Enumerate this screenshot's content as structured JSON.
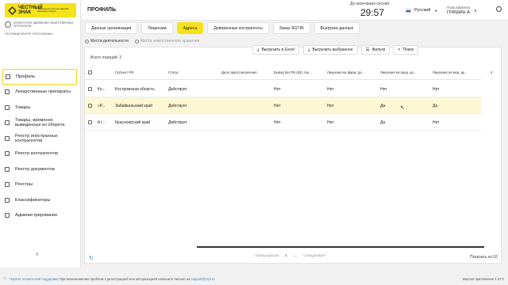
{
  "brand": {
    "name": "ЧЕСТНЫЙ ЗНАК",
    "subtitle": "национальная система цифровой маркировки товаров"
  },
  "org": {
    "name": "МОНИТОРИНГ ДВИЖЕНИЯ ЛЕКАРСТВЕННЫХ ПРЕПАРАТОВ",
    "center": "ТЕСТОВЫЙ КОНТУР «РЕСПУБЛИКА»"
  },
  "sidebar": {
    "items": [
      {
        "label": "Профиль",
        "icon": "person-icon"
      },
      {
        "label": "Лекарственные препараты",
        "icon": "pill-icon"
      },
      {
        "label": "Товары",
        "icon": "box-icon"
      },
      {
        "label": "Товары, временно выведенные из оборота",
        "icon": "box-out-icon"
      },
      {
        "label": "Реестр иностранных контрагентов",
        "icon": "globe-icon"
      },
      {
        "label": "Реестр контрагентов",
        "icon": "contacts-icon"
      },
      {
        "label": "Реестр документов",
        "icon": "document-icon"
      },
      {
        "label": "Реестры",
        "icon": "registry-icon"
      },
      {
        "label": "Классификаторы",
        "icon": "classifier-icon"
      },
      {
        "label": "Администрирование",
        "icon": "settings-icon"
      }
    ],
    "collapse": "≡"
  },
  "header": {
    "title": "ПРОФИЛЬ",
    "session_label": "До окончания сессии:",
    "timer": "29:57",
    "language": "Русский",
    "user_label": "Пользователь",
    "user_name": "ГРИШИН А."
  },
  "tabs": [
    {
      "label": "Данные организации",
      "active": false
    },
    {
      "label": "Лицензии",
      "active": false
    },
    {
      "label": "Адреса",
      "active": true
    },
    {
      "label": "Доверенные контрагенты",
      "active": false
    },
    {
      "label": "Заказ SGTIN",
      "active": false
    },
    {
      "label": "Выгрузка данных",
      "active": false
    }
  ],
  "radios": {
    "activity": "Места деятельности",
    "storage": "Места ответственного хранения"
  },
  "toolbar": {
    "export_excel": "Выгрузить в Excel",
    "export_selected": "Выгрузить выбранное",
    "filter": "Фильтр",
    "search": "Поиск"
  },
  "table": {
    "total": "Всего позиций: 3",
    "columns": [
      "Субъект РФ",
      "Статус",
      "Дата приостановления",
      "Вывод без РВ (521 схе...",
      "Лицензия на фарм. де...",
      "Лицензия на прод. де...",
      "Лицензия на мед. де..."
    ],
    "rows": [
      {
        "c0": "Ко...",
        "region": "Костромская область",
        "status": "Действует",
        "date": "",
        "rv": "Нет",
        "pharm": "Нет",
        "prod": "Нет",
        "med": "Нет"
      },
      {
        "c0": "«Р...",
        "region": "Забайкальский край",
        "status": "Действует",
        "date": "",
        "rv": "Нет",
        "pharm": "Нет",
        "prod": "Да",
        "med": "Да"
      },
      {
        "c0": "й г...",
        "region": "Красноярский край",
        "status": "Действует",
        "date": "",
        "rv": "Нет",
        "pharm": "Нет",
        "prod": "Да",
        "med": "Нет"
      }
    ]
  },
  "pagination": {
    "prev": "Предыдущая",
    "current": "1",
    "more": "...",
    "next": "Следующая",
    "show_by": "Показать по:",
    "show_by_value": "10"
  },
  "footer": {
    "support_link": "Портал технической поддержки",
    "notice": "При возникновении проблем с регистрацией или авторизацией напишите письмо на",
    "email": "support@crpt.ru",
    "version": "Версия приложения 4.37.0"
  }
}
